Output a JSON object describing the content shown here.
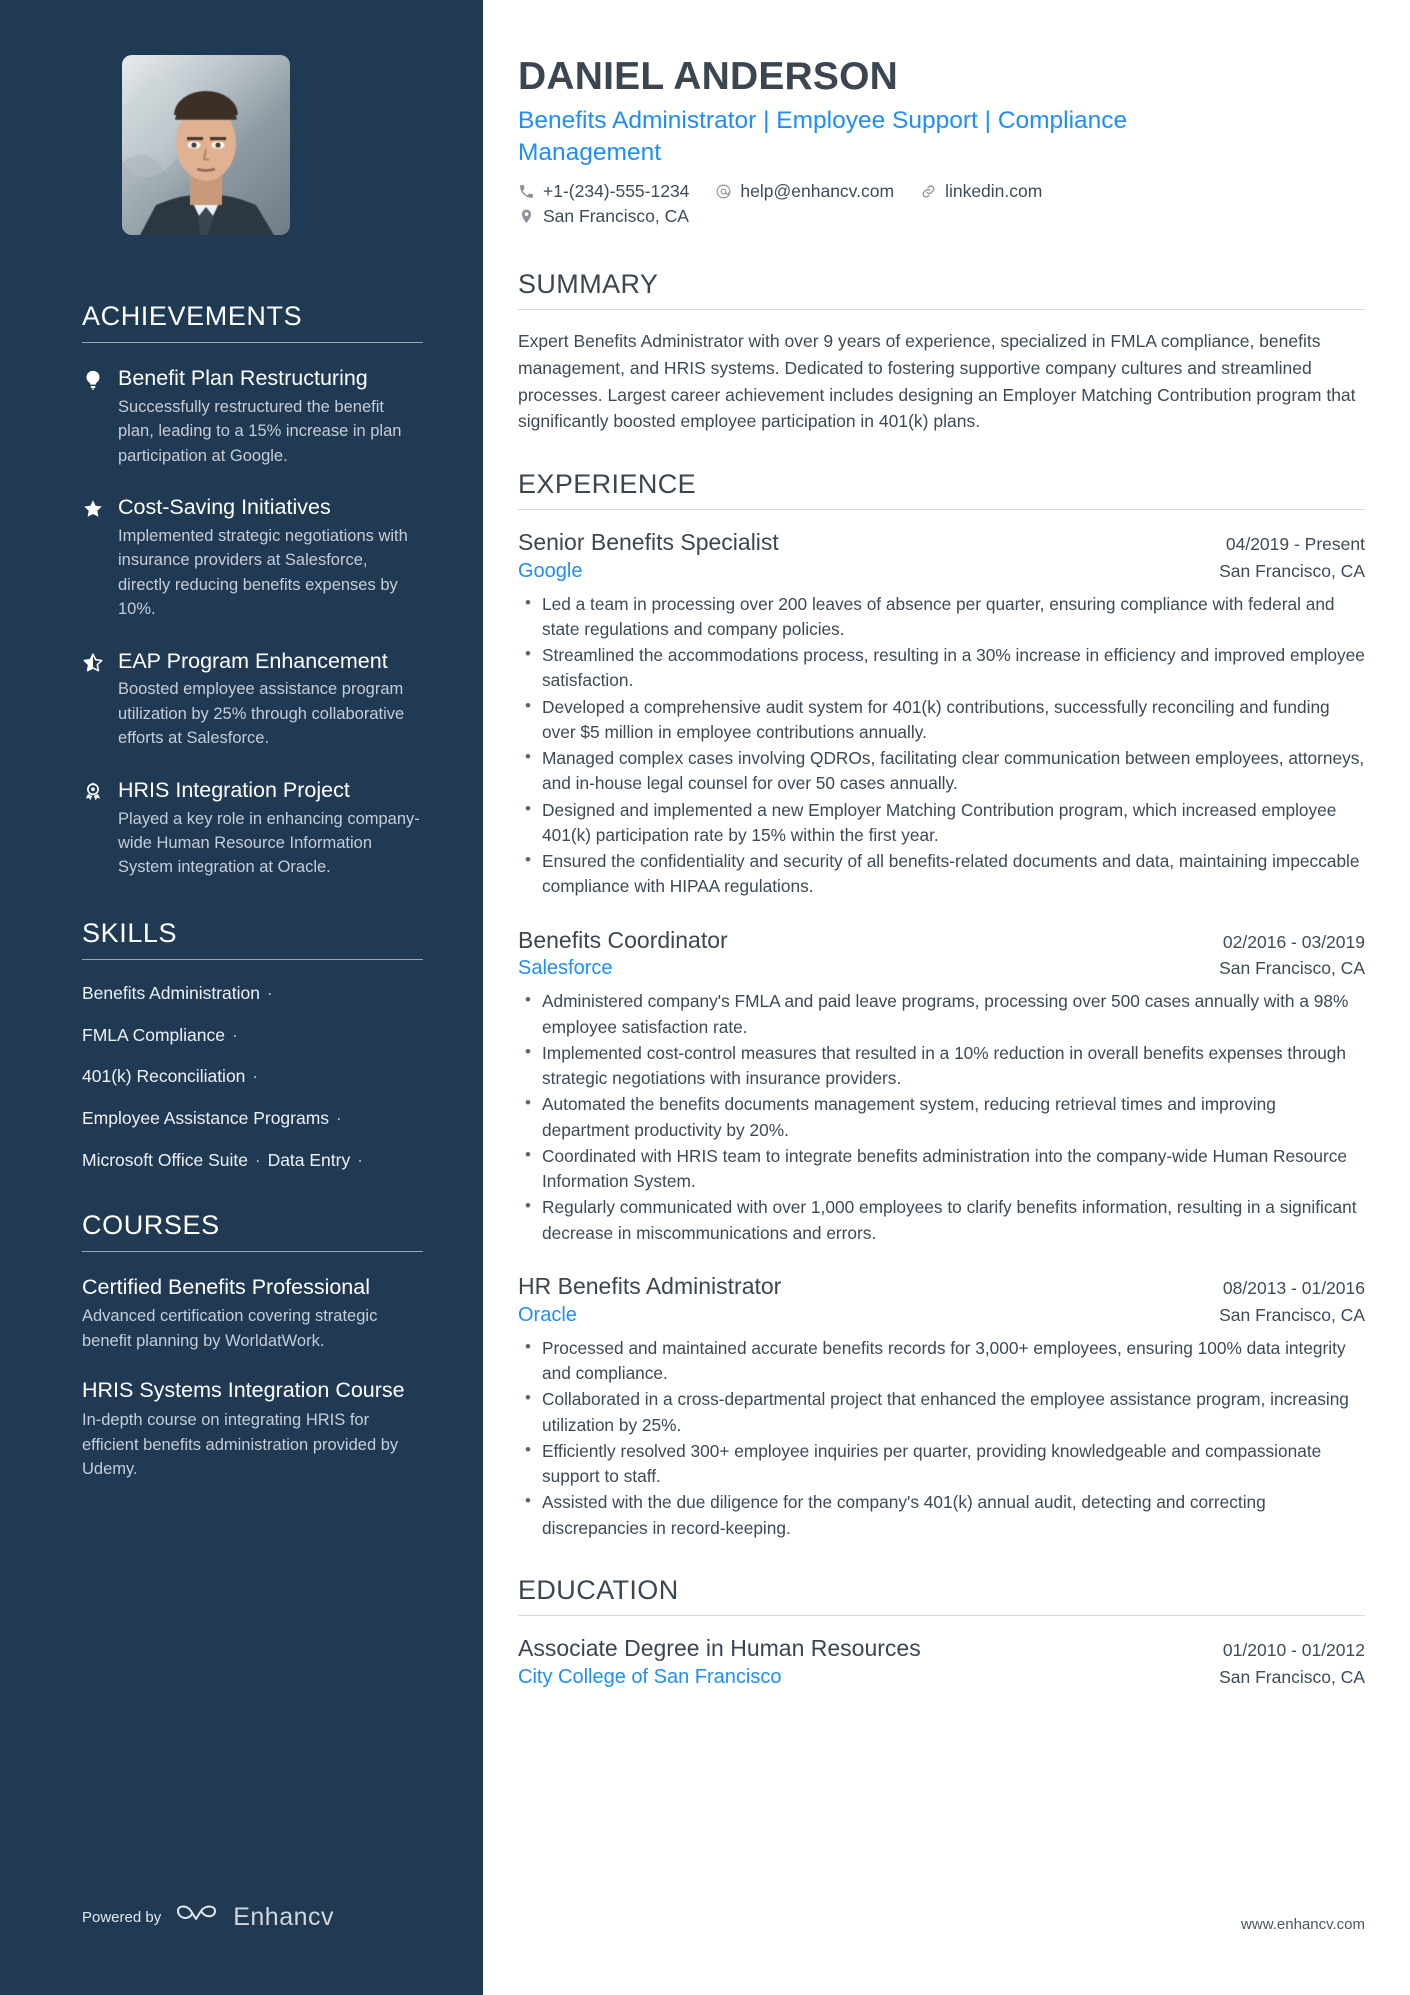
{
  "theme": {
    "sidebar_bg": "#203A53",
    "accent_blue": "#1f8ef7",
    "heading_dark": "#3b4650",
    "body_text": "#3c4a56"
  },
  "header": {
    "name": "DANIEL ANDERSON",
    "headline": "Benefits Administrator | Employee Support | Compliance Management",
    "contacts": {
      "phone": "+1-(234)-555-1234",
      "email": "help@enhancv.com",
      "linkedin": "linkedin.com",
      "location": "San Francisco, CA"
    }
  },
  "sidebar": {
    "achievements": {
      "heading": "ACHIEVEMENTS",
      "items": [
        {
          "icon": "lightbulb-icon",
          "title": "Benefit Plan Restructuring",
          "description": "Successfully restructured the benefit plan, leading to a 15% increase in plan participation at Google."
        },
        {
          "icon": "star-filled-icon",
          "title": "Cost-Saving Initiatives",
          "description": "Implemented strategic negotiations with insurance providers at Salesforce, directly reducing benefits expenses by 10%."
        },
        {
          "icon": "star-half-icon",
          "title": "EAP Program Enhancement",
          "description": "Boosted employee assistance program utilization by 25% through collaborative efforts at Salesforce."
        },
        {
          "icon": "award-medal-icon",
          "title": "HRIS Integration Project",
          "description": "Played a key role in enhancing company-wide Human Resource Information System integration at Oracle."
        }
      ]
    },
    "skills": {
      "heading": "SKILLS",
      "rows": [
        [
          "Benefits Administration"
        ],
        [
          "FMLA Compliance"
        ],
        [
          "401(k) Reconciliation"
        ],
        [
          "Employee Assistance Programs"
        ],
        [
          "Microsoft Office Suite",
          "Data Entry"
        ]
      ]
    },
    "courses": {
      "heading": "COURSES",
      "items": [
        {
          "title": "Certified Benefits Professional",
          "description": "Advanced certification covering strategic benefit planning by WorldatWork."
        },
        {
          "title": "HRIS Systems Integration Course",
          "description": "In-depth course on integrating HRIS for efficient benefits administration provided by Udemy."
        }
      ]
    },
    "footer": {
      "powered_label": "Powered by",
      "brand": "Enhancv"
    }
  },
  "main": {
    "summary": {
      "heading": "SUMMARY",
      "text": "Expert Benefits Administrator with over 9 years of experience, specialized in FMLA compliance, benefits management, and HRIS systems. Dedicated to fostering supportive company cultures and streamlined processes. Largest career achievement includes designing an Employer Matching Contribution program that significantly boosted employee participation in 401(k) plans."
    },
    "experience": {
      "heading": "EXPERIENCE",
      "jobs": [
        {
          "title": "Senior Benefits Specialist",
          "dates": "04/2019 - Present",
          "company": "Google",
          "location": "San Francisco, CA",
          "bullets": [
            "Led a team in processing over 200 leaves of absence per quarter, ensuring compliance with federal and state regulations and company policies.",
            "Streamlined the accommodations process, resulting in a 30% increase in efficiency and improved employee satisfaction.",
            "Developed a comprehensive audit system for 401(k) contributions, successfully reconciling and funding over $5 million in employee contributions annually.",
            "Managed complex cases involving QDROs, facilitating clear communication between employees, attorneys, and in-house legal counsel for over 50 cases annually.",
            "Designed and implemented a new Employer Matching Contribution program, which increased employee 401(k) participation rate by 15% within the first year.",
            "Ensured the confidentiality and security of all benefits-related documents and data, maintaining impeccable compliance with HIPAA regulations."
          ]
        },
        {
          "title": "Benefits Coordinator",
          "dates": "02/2016 - 03/2019",
          "company": "Salesforce",
          "location": "San Francisco, CA",
          "bullets": [
            "Administered company's FMLA and paid leave programs, processing over 500 cases annually with a 98% employee satisfaction rate.",
            "Implemented cost-control measures that resulted in a 10% reduction in overall benefits expenses through strategic negotiations with insurance providers.",
            "Automated the benefits documents management system, reducing retrieval times and improving department productivity by 20%.",
            "Coordinated with HRIS team to integrate benefits administration into the company-wide Human Resource Information System.",
            "Regularly communicated with over 1,000 employees to clarify benefits information, resulting in a significant decrease in miscommunications and errors."
          ]
        },
        {
          "title": "HR Benefits Administrator",
          "dates": "08/2013 - 01/2016",
          "company": "Oracle",
          "location": "San Francisco, CA",
          "bullets": [
            "Processed and maintained accurate benefits records for 3,000+ employees, ensuring 100% data integrity and compliance.",
            "Collaborated in a cross-departmental project that enhanced the employee assistance program, increasing utilization by 25%.",
            "Efficiently resolved 300+ employee inquiries per quarter, providing knowledgeable and compassionate support to staff.",
            "Assisted with the due diligence for the company's 401(k) annual audit, detecting and correcting discrepancies in record-keeping."
          ]
        }
      ]
    },
    "education": {
      "heading": "EDUCATION",
      "entries": [
        {
          "degree": "Associate Degree in Human Resources",
          "dates": "01/2010 - 01/2012",
          "school": "City College of San Francisco",
          "location": "San Francisco, CA"
        }
      ]
    },
    "footer_url": "www.enhancv.com"
  }
}
